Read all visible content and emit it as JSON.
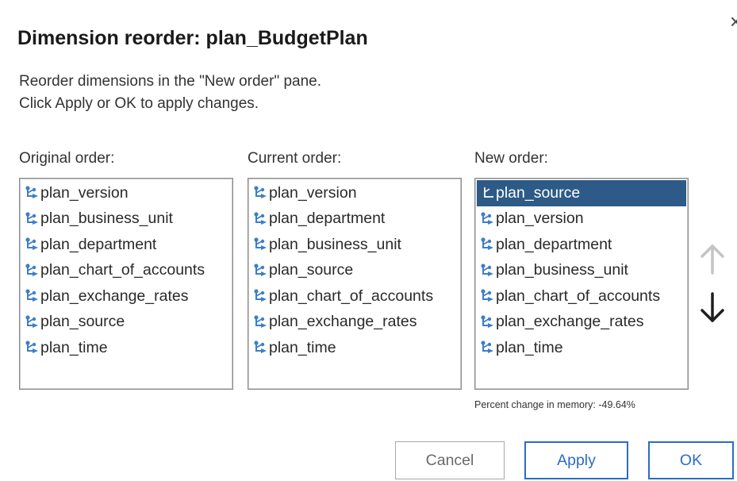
{
  "dialog": {
    "title": "Dimension reorder: plan_BudgetPlan",
    "close_label": "×",
    "instructions": [
      "Reorder dimensions in the \"New order\" pane.",
      "Click Apply or OK to apply changes."
    ]
  },
  "panes": {
    "original": {
      "label": "Original order:",
      "items": [
        "plan_version",
        "plan_business_unit",
        "plan_department",
        "plan_chart_of_accounts",
        "plan_exchange_rates",
        "plan_source",
        "plan_time"
      ]
    },
    "current": {
      "label": "Current order:",
      "items": [
        "plan_version",
        "plan_department",
        "plan_business_unit",
        "plan_source",
        "plan_chart_of_accounts",
        "plan_exchange_rates",
        "plan_time"
      ]
    },
    "new": {
      "label": "New order:",
      "items": [
        "plan_source",
        "plan_version",
        "plan_department",
        "plan_business_unit",
        "plan_chart_of_accounts",
        "plan_exchange_rates",
        "plan_time"
      ],
      "selected_item": "plan_source"
    }
  },
  "controls": {
    "move_up_icon": "arrow-up-icon",
    "move_up_enabled": false,
    "move_down_icon": "arrow-down-icon",
    "move_down_enabled": true
  },
  "memory": {
    "percent_change_text": "Percent change in memory: -49.64%"
  },
  "buttons": {
    "cancel": "Cancel",
    "apply": "Apply",
    "ok": "OK"
  },
  "colors": {
    "selection_bg": "#2d5a86",
    "accent": "#2c6dc4",
    "disabled_arrow": "#c4c4c4",
    "icon_blue": "#3d7fc8"
  }
}
